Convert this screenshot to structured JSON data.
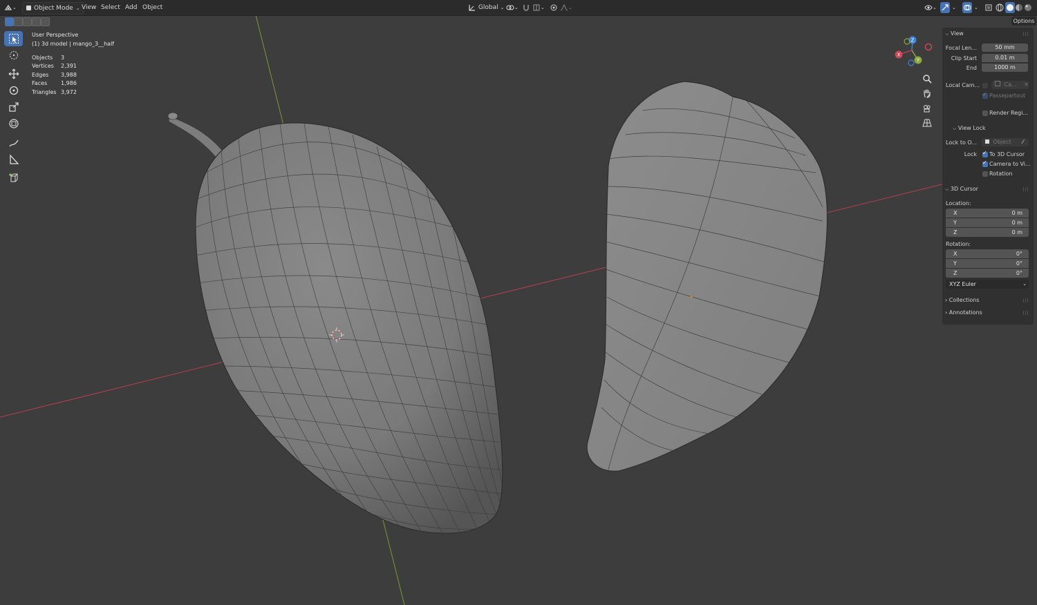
{
  "header": {
    "mode": "Object Mode",
    "menus": [
      "View",
      "Select",
      "Add",
      "Object"
    ],
    "transform_orientation": "Global",
    "options_label": "Options"
  },
  "viewport": {
    "view_name": "User Perspective",
    "object_info": "(1) 3d model | mango_3__half",
    "stats": [
      {
        "label": "Objects",
        "value": "3"
      },
      {
        "label": "Vertices",
        "value": "2,391"
      },
      {
        "label": "Edges",
        "value": "3,988"
      },
      {
        "label": "Faces",
        "value": "1,986"
      },
      {
        "label": "Triangles",
        "value": "3,972"
      }
    ],
    "gizmo_axes": [
      "X",
      "Y",
      "Z"
    ]
  },
  "tools": [
    "select-box",
    "cursor",
    "move",
    "rotate",
    "scale",
    "transform",
    "annotate",
    "measure",
    "add-cube"
  ],
  "npanel": {
    "view_header": "View",
    "focal_length_label": "Focal Len...",
    "focal_length_value": "50 mm",
    "clip_start_label": "Clip Start",
    "clip_start_value": "0.01 m",
    "clip_end_label": "End",
    "clip_end_value": "1000 m",
    "local_camera_label": "Local Cam...",
    "local_camera_value": "Ca...",
    "passepartout_label": "Passepartout",
    "render_region_label": "Render Regi...",
    "view_lock_header": "View Lock",
    "lock_to_object_label": "Lock to O...",
    "lock_to_object_placeholder": "Object",
    "lock_label": "Lock",
    "lock_to_3d_cursor": "To 3D Cursor",
    "camera_to_view": "Camera to Vi...",
    "rotation_check": "Rotation",
    "cursor_header": "3D Cursor",
    "location_label": "Location:",
    "location": [
      {
        "axis": "X",
        "value": "0 m"
      },
      {
        "axis": "Y",
        "value": "0 m"
      },
      {
        "axis": "Z",
        "value": "0 m"
      }
    ],
    "rotation_label": "Rotation:",
    "rotation": [
      {
        "axis": "X",
        "value": "0°"
      },
      {
        "axis": "Y",
        "value": "0°"
      },
      {
        "axis": "Z",
        "value": "0°"
      }
    ],
    "rotation_mode": "XYZ Euler",
    "collections_header": "Collections",
    "annotations_header": "Annotations"
  },
  "colors": {
    "viewport_bg": "#3d3d3d",
    "accent": "#4772b3",
    "x_axis": "#b5404f",
    "y_axis": "#8aa83b",
    "z_axis": "#3f84d9"
  }
}
